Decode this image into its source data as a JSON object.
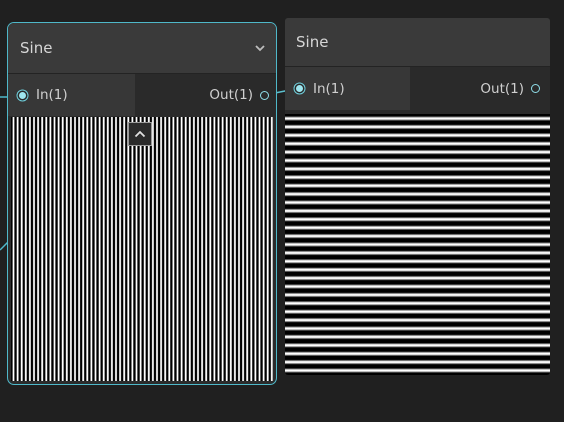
{
  "nodes": [
    {
      "title": "Sine",
      "selected": true,
      "input_label": "In(1)",
      "output_label": "Out(1)",
      "pattern": "vertical-stripes",
      "icons": [
        "chevron-down-icon",
        "chevron-up-icon"
      ]
    },
    {
      "title": "Sine",
      "selected": false,
      "input_label": "In(1)",
      "output_label": "Out(1)",
      "pattern": "horizontal-stripes"
    }
  ],
  "colors": {
    "background": "#202020",
    "node_body": "#2b2b2b",
    "node_header": "#3a3a3a",
    "selection_outline": "#4fb8c9",
    "connection": "#6fcfdc"
  }
}
